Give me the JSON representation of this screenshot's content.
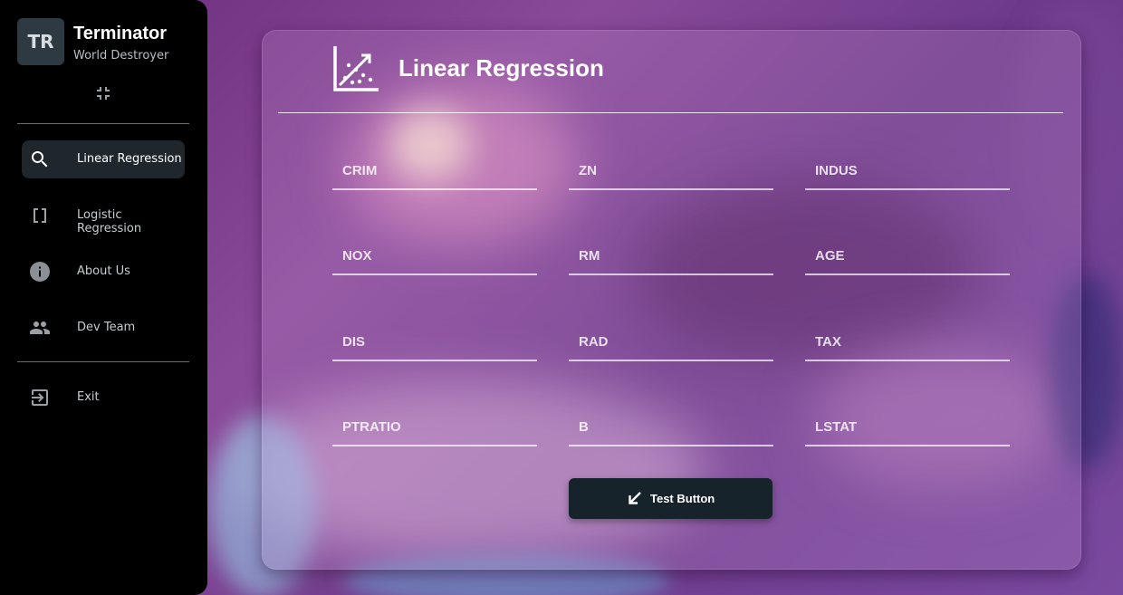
{
  "user": {
    "initials": "TR",
    "name": "Terminator",
    "role": "World Destroyer"
  },
  "sidebar": {
    "items": [
      {
        "label": "Linear Regression",
        "icon": "search-icon",
        "active": true
      },
      {
        "label": "Logistic Regression",
        "icon": "brackets-icon",
        "active": false
      },
      {
        "label": "About Us",
        "icon": "info-icon",
        "active": false
      },
      {
        "label": "Dev Team",
        "icon": "people-icon",
        "active": false
      }
    ],
    "exit_label": "Exit"
  },
  "main": {
    "title": "Linear Regression",
    "fields": [
      "CRIM",
      "ZN",
      "INDUS",
      "NOX",
      "RM",
      "AGE",
      "DIS",
      "RAD",
      "TAX",
      "PTRATIO",
      "B",
      "LSTAT"
    ],
    "button_label": "Test Button"
  },
  "colors": {
    "sidebar_bg": "#000000",
    "active_item_bg": "#1f272c",
    "button_bg": "#17232b",
    "avatar_bg": "#2e3a41"
  }
}
